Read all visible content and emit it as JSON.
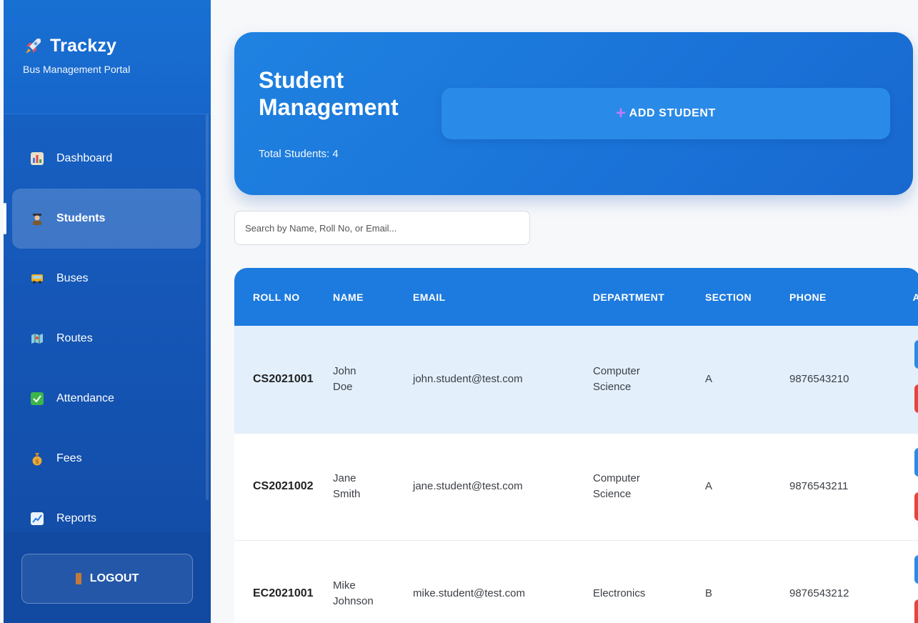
{
  "brand": {
    "title": "Trackzy",
    "subtitle": "Bus Management Portal"
  },
  "nav": [
    {
      "label": "Dashboard",
      "icon": "bar-chart-icon",
      "active": false
    },
    {
      "label": "Students",
      "icon": "student-icon",
      "active": true
    },
    {
      "label": "Buses",
      "icon": "bus-icon",
      "active": false
    },
    {
      "label": "Routes",
      "icon": "map-icon",
      "active": false
    },
    {
      "label": "Attendance",
      "icon": "check-icon",
      "active": false
    },
    {
      "label": "Fees",
      "icon": "money-bag-icon",
      "active": false
    },
    {
      "label": "Reports",
      "icon": "trend-chart-icon",
      "active": false
    }
  ],
  "logout": {
    "label": "LOGOUT"
  },
  "header": {
    "title_line1": "Student",
    "title_line2": "Management",
    "total": "Total Students: 4",
    "add_label": "ADD STUDENT"
  },
  "search": {
    "placeholder": "Search by Name, Roll No, or Email..."
  },
  "table": {
    "columns": [
      "ROLL NO",
      "NAME",
      "EMAIL",
      "DEPARTMENT",
      "SECTION",
      "PHONE",
      "A"
    ],
    "rows": [
      {
        "roll": "CS2021001",
        "name1": "John",
        "name2": "Doe",
        "email": "john.student@test.com",
        "dept1": "Computer",
        "dept2": "Science",
        "section": "A",
        "phone": "9876543210"
      },
      {
        "roll": "CS2021002",
        "name1": "Jane",
        "name2": "Smith",
        "email": "jane.student@test.com",
        "dept1": "Computer",
        "dept2": "Science",
        "section": "A",
        "phone": "9876543211"
      },
      {
        "roll": "EC2021001",
        "name1": "Mike",
        "name2": "Johnson",
        "email": "mike.student@test.com",
        "dept1": "Electronics",
        "dept2": "",
        "section": "B",
        "phone": "9876543212"
      }
    ]
  },
  "colors": {
    "primary": "#1d7ade",
    "sidebar": "#1556b6",
    "danger": "#e5453e",
    "highlight": "#e3f0fc"
  }
}
